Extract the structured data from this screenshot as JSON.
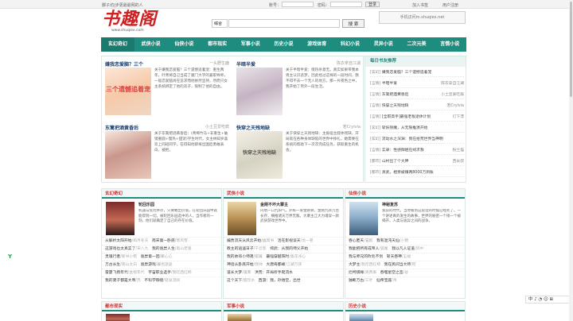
{
  "topbar": {
    "notice": "脚子坊|步更最最网的人",
    "account_label": "账号：",
    "password_label": "密码：",
    "login_button": "登录",
    "bookmark_link": "加入书签",
    "register_link": "用户注册"
  },
  "logo": {
    "title": "书趣阁",
    "url": "www.shuqiex.com"
  },
  "search": {
    "category": "综合",
    "placeholder": "",
    "button_label": "搜 索"
  },
  "domain_box": "手机访问m.shuqiex.net",
  "nav": [
    "玄幻奇幻",
    "武侠小说",
    "仙侠小说",
    "都市现实",
    "军事小说",
    "历史小说",
    "游戏体育",
    "科幻小说",
    "灵异小说",
    "二次元美",
    "言情小说"
  ],
  "hot": [
    {
      "title": "嫌我恋爱脑？三个",
      "author": "一头野生鹿",
      "desc": "关于嫌我恋爱脑？三个遗憾追着宠：重生两年，叶青将自己当成了厦门大学的兼职导师，一般恋爱脑尚在追求而他依然坚持，然而只女主系统绑定了他的双子，限制了他的自由。",
      "cover_text": "三个遗憾追着宠"
    },
    {
      "title": "半暗半爱",
      "author": "陈衣拿自江湖",
      "desc": "关于半暗半爱：情热杀意无。真实如果带我本男主认识恶梦。因此经过这样的一段时间，我不得不去一个无人的地方，那一片夜色之中，我开始了另外一段生活。",
      "cover_text": ""
    },
    {
      "title": "东篱把酒黄昏后",
      "author": "小土豆爱吃腐",
      "desc": "关于东篱把酒黄昏后：(青梅竹马+非重生+破镜重圆+慢热+甜宠)学生时代，女主林知岁喜欢上同班同学，在得知他即将出国后勇敢表白，被拒。",
      "cover_text": ""
    },
    {
      "title": "快穿之天残地缺",
      "author": "若Crylvia",
      "desc": "关于快穿之天残地缺：主角宿主肢体残缺，开局就在各种身体缺陷的世界中挣扎，她需要在系统的帮助下一次次完成任务，获取重生的机会。",
      "cover_text": "快穿之天残地缺"
    }
  ],
  "rank": {
    "header": "每日书友推荐",
    "rows": [
      {
        "cat": "[玄幻]",
        "title": "嫌我恋爱脑？三个遗憾追着宠",
        "author": ""
      },
      {
        "cat": "[言情]",
        "title": "半暗半爱",
        "author": "陈衣拿自江湖"
      },
      {
        "cat": "[言情]",
        "title": "东篱把酒黄昏后",
        "author": "小土豆爱吃腐"
      },
      {
        "cat": "[言情]",
        "title": "快穿之天残地缺",
        "author": "若Crylvia"
      },
      {
        "cat": "[言情]",
        "title": "[全职高手]最强老板退休计划",
        "author": "灯下漂"
      },
      {
        "cat": "[玄幻]",
        "title": "斩妖除魔，从无限推演开始",
        "author": ""
      },
      {
        "cat": "[玄幻]",
        "title": "流动水之深渊：我在拾荒世界当神明",
        "author": ""
      },
      {
        "cat": "[言情]",
        "title": "实录：性感御姐在线求救",
        "author": "粉兰猫"
      },
      {
        "cat": "[都市]",
        "title": "山村出了个大神",
        "author": "西米叔"
      },
      {
        "cat": "[都市]",
        "title": "真武，相亲被赚两8000万到账",
        "author": ""
      }
    ]
  },
  "sections": [
    {
      "title": "玄幻奇幻",
      "feat_title": "轮回乐园",
      "feat_desc": "机遇与危险并存，只要敢出价值，在轮回乐园中就能得到一切。被轮回乐园选中的人，当作者的一刻，他们就确定了自己的存在价值。",
      "rows": [
        {
          "t": "从解析太阳开始",
          "a": "/如月冬天"
        },
        {
          "t": "南宋第一卧底",
          "a": "/寒风雪"
        },
        {
          "t": "这游戏也太真实了",
          "a": "/宋八九"
        },
        {
          "t": "我的诡异人生",
          "a": "/黑山老鬼"
        },
        {
          "t": "灵魂行者",
          "a": "/新书小筑"
        },
        {
          "t": "诡异第一因",
          "a": "/聚心心"
        },
        {
          "t": "万古长生",
          "a": "/南山太白"
        },
        {
          "t": "诡异游戏",
          "a": "/暮色迷途"
        },
        {
          "t": "雷霆飞扬年代",
          "a": "/金榜年代"
        },
        {
          "t": "宇宙职业选手",
          "a": "/我吃西红柿"
        },
        {
          "t": "我的弟子都是大帝",
          "a": "/苏"
        },
        {
          "t": "不科学御兽",
          "a": "/轻泉流响"
        }
      ]
    },
    {
      "title": "武侠小说",
      "feat_title": "金刚不坏大寨主",
      "feat_desc": "内地一口九阳气，外练一身金刚骨，金刚九转万古长存，横推诸天万界无敌。大寨主江大力魂穿一款武侠游戏世界中。",
      "rows": [
        {
          "t": "编贾流天从风云开始",
          "a": "/幽冥书"
        },
        {
          "t": "活在影视谈天",
          "a": "/龙一卷"
        },
        {
          "t": "教主的逍遥日子",
          "a": "/千云客"
        },
        {
          "t": "综武：从我的师父开始",
          "a": ""
        },
        {
          "t": "我的帅哥小师弟",
          "a": "/鲲翼"
        },
        {
          "t": "最强穿越阵时",
          "a": "/毒花冰心"
        },
        {
          "t": "神话从卧底开始",
          "a": "/我帅"
        },
        {
          "t": "大唐奇都峰",
          "a": "/江湖万侠"
        },
        {
          "t": "道长大梦",
          "a": "/蓬莱"
        },
        {
          "t": "洪荒：开局听手爬流水",
          "a": ""
        },
        {
          "t": "这个天下",
          "a": "/鹿饮水"
        },
        {
          "t": "西游：我，孙悟空，出世",
          "a": ""
        }
      ]
    },
    {
      "title": "仙侠小说",
      "feat_title": "神秘复苏",
      "feat_desc": "诡异的时代，当你看到这段话的时候已经死了。一个讲述真的发生的故事，世界的秘密一个接一个被揭开，人类与诡异之间的战争。",
      "rows": [
        {
          "t": "吞心匿天",
          "a": "/猫腻"
        },
        {
          "t": "我有混沌天仙",
          "a": "/小猪"
        },
        {
          "t": "我能把所有成帝人",
          "a": "/狐尾"
        },
        {
          "t": "我以凡人证道",
          "a": "/风中"
        },
        {
          "t": "我与师兄的吹毛不剑",
          "a": ""
        },
        {
          "t": "斩天吞神",
          "a": "/五福"
        },
        {
          "t": "大梦主",
          "a": "/我吃西红柿"
        },
        {
          "t": "我在民间当大师",
          "a": "/阿"
        },
        {
          "t": "烂柯棋缘",
          "a": "/真费事"
        },
        {
          "t": "吞噬星空之签",
          "a": "/谷"
        },
        {
          "t": "独断万古",
          "a": "/三叶"
        },
        {
          "t": "仙帝宝座",
          "a": "/吊"
        }
      ]
    }
  ],
  "sections_bottom": [
    "都市现实",
    "军事小说",
    "历史小说"
  ],
  "ime": "中 ♪ ◔ ☺ ⊞",
  "colors": {
    "nav": "#1e8c7e",
    "accent": "#c22",
    "link": "#1a3e6e"
  }
}
